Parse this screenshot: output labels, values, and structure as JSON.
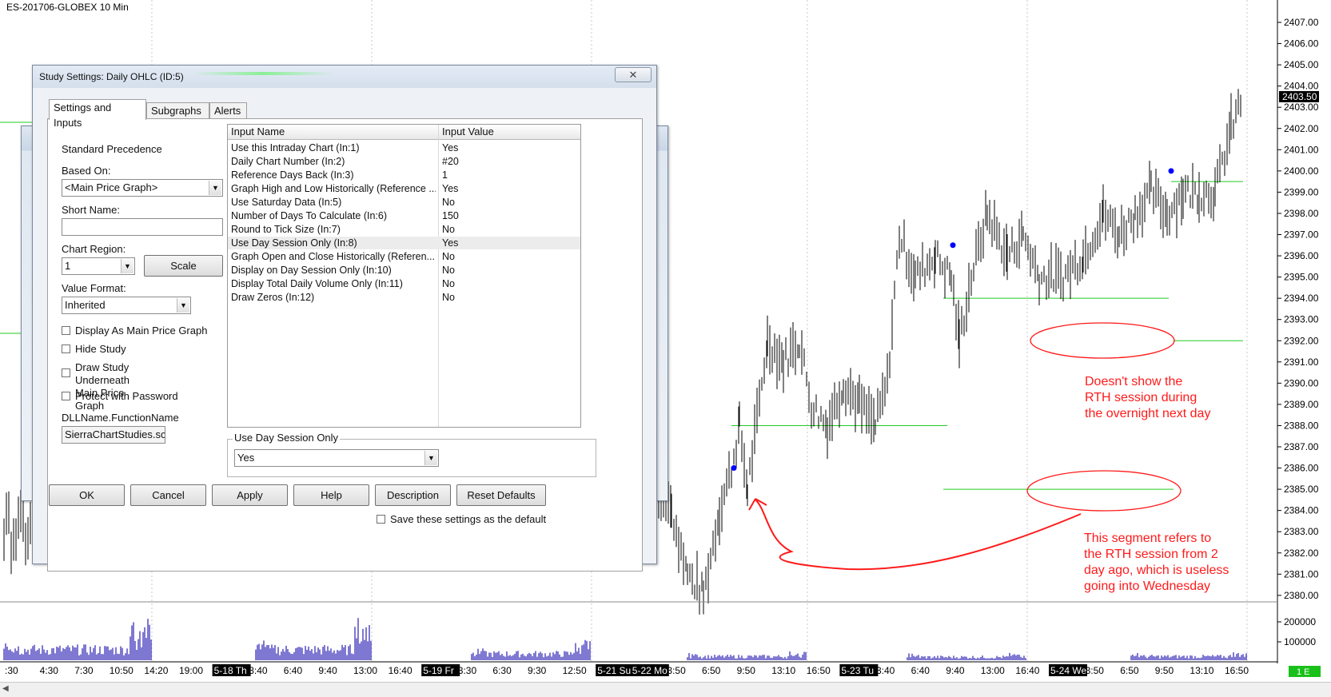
{
  "chart": {
    "title": "ES-201706-GLOBEX  10 Min",
    "price_axis_labels": [
      "2407.00",
      "2406.00",
      "2405.00",
      "2404.00",
      "2403.00",
      "2402.00",
      "2401.00",
      "2400.00",
      "2399.00",
      "2398.00",
      "2397.00",
      "2396.00",
      "2395.00",
      "2394.00",
      "2393.00",
      "2392.00",
      "2391.00",
      "2390.00",
      "2389.00",
      "2388.00",
      "2387.00",
      "2386.00",
      "2385.00",
      "2384.00",
      "2383.00",
      "2382.00",
      "2381.00",
      "2380.00"
    ],
    "current_price": "2403.50",
    "volume_axis_labels": [
      "200000",
      "100000"
    ],
    "volume_badge": "1 E",
    "time_labels": [
      {
        "text": ":30",
        "boxed": false
      },
      {
        "text": "4:30",
        "boxed": false
      },
      {
        "text": "7:30",
        "boxed": false
      },
      {
        "text": "10:50",
        "boxed": false
      },
      {
        "text": "14:20",
        "boxed": false
      },
      {
        "text": "19:00",
        "boxed": false
      },
      {
        "text": "5-18 Th",
        "boxed": true
      },
      {
        "text": "3:40",
        "boxed": false
      },
      {
        "text": "6:40",
        "boxed": false
      },
      {
        "text": "9:40",
        "boxed": false
      },
      {
        "text": "13:00",
        "boxed": false
      },
      {
        "text": "16:40",
        "boxed": false
      },
      {
        "text": "5-19 Fr",
        "boxed": true
      },
      {
        "text": "3:30",
        "boxed": false
      },
      {
        "text": "6:30",
        "boxed": false
      },
      {
        "text": "9:30",
        "boxed": false
      },
      {
        "text": "12:50",
        "boxed": false
      },
      {
        "text": "5-21 Su",
        "boxed": true
      },
      {
        "text": "5-22 Mo",
        "boxed": true
      },
      {
        "text": "3:50",
        "boxed": false
      },
      {
        "text": "6:50",
        "boxed": false
      },
      {
        "text": "9:50",
        "boxed": false
      },
      {
        "text": "13:10",
        "boxed": false
      },
      {
        "text": "16:50",
        "boxed": false
      },
      {
        "text": "5-23 Tu",
        "boxed": true
      },
      {
        "text": "3:40",
        "boxed": false
      },
      {
        "text": "6:40",
        "boxed": false
      },
      {
        "text": "9:40",
        "boxed": false
      },
      {
        "text": "13:00",
        "boxed": false
      },
      {
        "text": "16:40",
        "boxed": false
      },
      {
        "text": "5-24 We",
        "boxed": true
      },
      {
        "text": "3:50",
        "boxed": false
      },
      {
        "text": "6:50",
        "boxed": false
      },
      {
        "text": "9:50",
        "boxed": false
      },
      {
        "text": "13:10",
        "boxed": false
      },
      {
        "text": "16:50",
        "boxed": false
      }
    ],
    "colors": {
      "bars": "#000000",
      "ohlc_lines": "#22cc22",
      "volume": "#2a1fb3",
      "annotation": "#ff1a1a",
      "marker": "#0000ff"
    }
  },
  "annotations": {
    "note_top": "Doesn't show the\nRTH session during\nthe overnight next day",
    "note_bottom": "This segment refers to\nthe RTH session from 2\nday ago, which is useless\ngoing into Wednesday"
  },
  "dialog": {
    "title": "Study Settings: Daily OHLC (ID:5)",
    "close_glyph": "✕",
    "tabs": [
      "Settings and Inputs",
      "Subgraphs",
      "Alerts"
    ],
    "left": {
      "standard_precedence": "Standard Precedence",
      "based_on_label": "Based On:",
      "based_on_value": "<Main Price Graph>",
      "short_name_label": "Short Name:",
      "short_name_value": "",
      "chart_region_label": "Chart Region:",
      "chart_region_value": "1",
      "scale_button": "Scale",
      "value_format_label": "Value Format:",
      "value_format_value": "Inherited",
      "checkboxes": [
        "Display As Main Price Graph",
        "Hide Study",
        "Draw Study Underneath\nMain Price Graph",
        "Protect with Password"
      ],
      "dll_label": "DLLName.FunctionName",
      "dll_value": "SierraChartStudies.scs"
    },
    "inputs_table": {
      "headers": [
        "Input Name",
        "Input Value"
      ],
      "rows": [
        [
          "Use this Intraday Chart  (In:1)",
          "Yes"
        ],
        [
          "Daily Chart Number  (In:2)",
          "#20"
        ],
        [
          "Reference Days Back  (In:3)",
          "1"
        ],
        [
          "Graph High and Low Historically (Reference ...",
          "Yes"
        ],
        [
          "Use Saturday Data  (In:5)",
          "No"
        ],
        [
          "Number of Days To Calculate  (In:6)",
          "150"
        ],
        [
          "Round to Tick Size  (In:7)",
          "No"
        ],
        [
          "Use Day Session Only  (In:8)",
          "Yes"
        ],
        [
          "Graph Open and Close Historically (Referen...",
          "No"
        ],
        [
          "Display on Day Session Only  (In:10)",
          "No"
        ],
        [
          "Display Total Daily Volume Only  (In:11)",
          "No"
        ],
        [
          "Draw Zeros  (In:12)",
          "No"
        ]
      ],
      "selected_row": 7
    },
    "edit_group_label": "Use Day Session Only",
    "edit_group_value": "Yes",
    "buttons": [
      "OK",
      "Cancel",
      "Apply",
      "Help",
      "Description",
      "Reset Defaults"
    ],
    "save_default_label": "Save these settings as the default"
  }
}
